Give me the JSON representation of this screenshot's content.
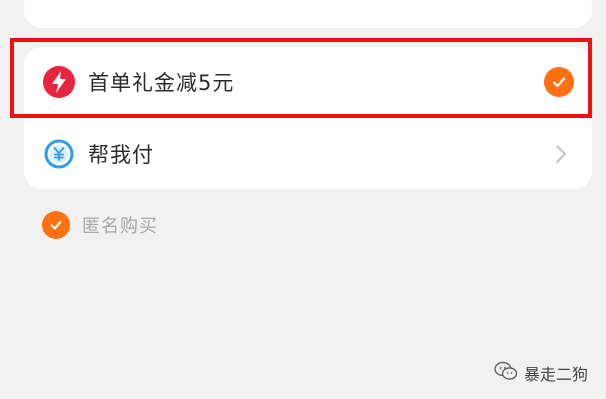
{
  "options": {
    "coupon": {
      "label": "首单礼金减5元",
      "icon": "lightning-icon",
      "selected": true
    },
    "pay_for_me": {
      "label": "帮我付",
      "icon": "yen-coin-icon"
    }
  },
  "anonymous_purchase": {
    "label": "匿名购买",
    "checked": true
  },
  "watermark": {
    "text": "暴走二狗",
    "icon": "wechat-icon"
  },
  "colors": {
    "accent_orange": "#ff7010",
    "coupon_red": "#e8243f",
    "pay_blue": "#2e9be8",
    "highlight_red": "#ef1111"
  }
}
